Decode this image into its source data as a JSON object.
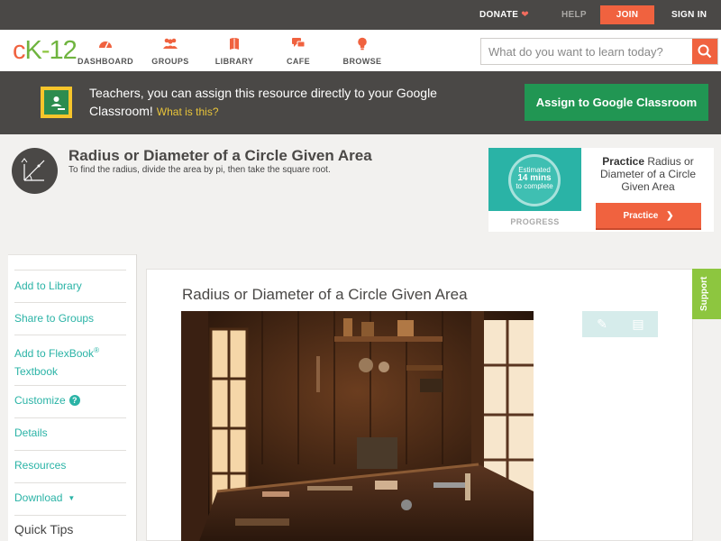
{
  "topbar": {
    "donate": "DONATE",
    "help": "HELP",
    "join": "JOIN",
    "sign_in": "SIGN IN"
  },
  "brand": {
    "logo_c": "c",
    "logo_k": "K",
    "logo_dash": "-",
    "logo_num": "12"
  },
  "nav": {
    "dashboard": "DASHBOARD",
    "groups": "GROUPS",
    "library": "LIBRARY",
    "cafe": "CAFE",
    "browse": "BROWSE"
  },
  "search": {
    "placeholder": "What do you want to learn today?"
  },
  "banner": {
    "text": "Teachers, you can assign this resource directly to your Google Classroom!",
    "what_link": "What is this?",
    "assign_button": "Assign to Google Classroom"
  },
  "concept": {
    "title": "Radius or Diameter of a Circle Given Area",
    "description": "To find the radius, divide the area by pi, then take the square root."
  },
  "practice": {
    "estimated": "Estimated",
    "minutes": "14 mins",
    "to_complete": "to complete",
    "progress_label": "PROGRESS",
    "practice_word": "Practice",
    "practice_topic": "Radius or Diameter of a Circle Given Area",
    "button": "Practice"
  },
  "sidebar": {
    "add_to_library": "Add to Library",
    "share_to_groups": "Share to Groups",
    "add_to_flexbook": "Add to FlexBook",
    "flexbook_reg": "®",
    "textbook": "Textbook",
    "customize": "Customize",
    "details": "Details",
    "resources": "Resources",
    "download": "Download",
    "quick_tips": "Quick Tips"
  },
  "content": {
    "title": "Radius or Diameter of a Circle Given Area"
  },
  "support": "Support",
  "colors": {
    "brand_orange": "#f0623f",
    "brand_green": "#8dc63f",
    "teal": "#2ab3a6",
    "classroom_green": "#219653",
    "dark_bar": "#4a4846"
  }
}
